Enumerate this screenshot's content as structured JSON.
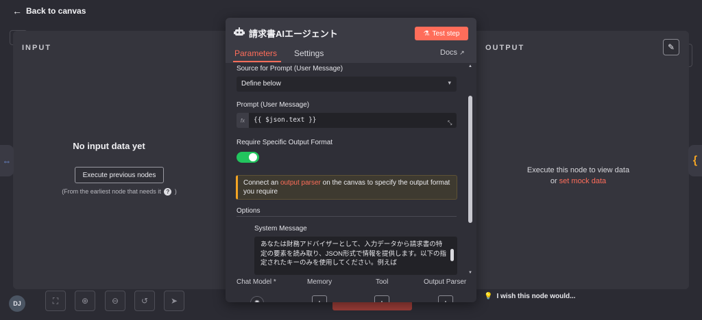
{
  "canvas": {
    "back_label": "Back to canvas",
    "avatar_initials": "DJ",
    "wish_label": "I wish this node would..."
  },
  "input_panel": {
    "title": "INPUT",
    "empty_title": "No input data yet",
    "execute_button": "Execute previous nodes",
    "hint_before": "(From the earliest node that needs it",
    "hint_after": ")"
  },
  "output_panel": {
    "title": "OUTPUT",
    "line1": "Execute this node to view data",
    "line2_prefix": "or",
    "mock_link": "set mock data"
  },
  "node": {
    "title": "請求書AIエージェント",
    "test_button": "Test step",
    "tabs": [
      {
        "label": "Parameters",
        "active": true
      },
      {
        "label": "Settings",
        "active": false
      }
    ],
    "docs_label": "Docs",
    "source_label": "Source for Prompt (User Message)",
    "source_value": "Define below",
    "prompt_label": "Prompt (User Message)",
    "prompt_value": "{{ $json.text }}",
    "output_format_label": "Require Specific Output Format",
    "output_format_enabled": true,
    "notice": {
      "before": "Connect an",
      "highlight": "output parser",
      "after": "on the canvas to specify the output format you require"
    },
    "options_label": "Options",
    "system_message_label": "System Message",
    "system_message": "あなたは財務アドバイザーとして、入力データから請求書の特定の要素を読み取り、JSON形式で情報を提供します。以下の指定されたキーのみを使用してください。例えば",
    "sub_nodes": [
      {
        "label": "Chat Model *"
      },
      {
        "label": "Memory"
      },
      {
        "label": "Tool"
      },
      {
        "label": "Output Parser"
      }
    ]
  },
  "colors": {
    "accent": "#ff6d5a",
    "toggle_on": "#22c55e",
    "warning": "#f5a524"
  }
}
